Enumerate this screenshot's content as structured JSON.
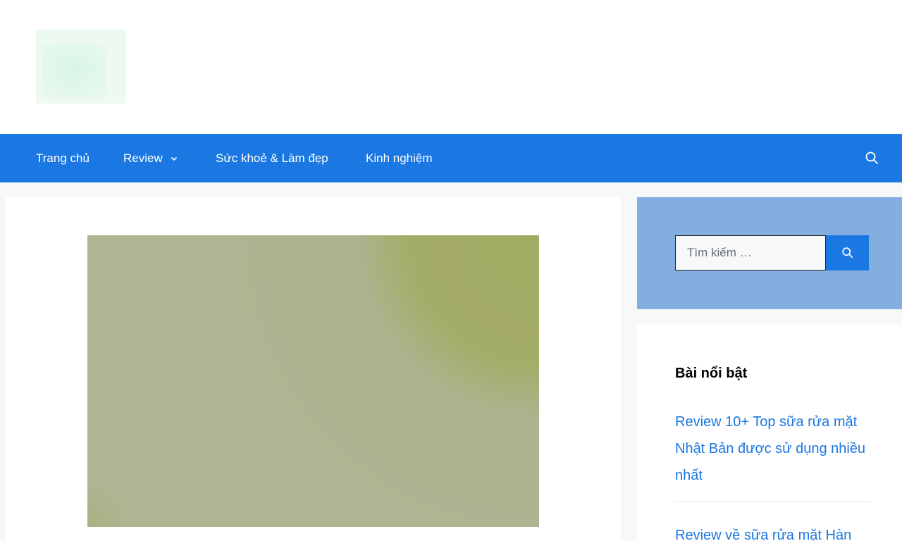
{
  "nav": {
    "items": [
      {
        "label": "Trang chủ"
      },
      {
        "label": "Review",
        "has_dropdown": true
      },
      {
        "label": "Sức khoẻ & Làm đẹp"
      },
      {
        "label": "Kinh nghiệm"
      }
    ],
    "search_icon": "search-icon"
  },
  "sidebar": {
    "search": {
      "placeholder": "Tìm kiếm …",
      "button_icon": "search-icon"
    },
    "featured": {
      "title": "Bài nổi bật",
      "posts": [
        {
          "title": "Review 10+ Top sữa rửa mặt Nhật Bản được sử dụng nhiều nhất"
        },
        {
          "title": "Review về sữa rửa mặt Hàn"
        }
      ]
    }
  },
  "colors": {
    "accent": "#1b78e2",
    "search_widget_bg": "#84aedf",
    "page_bg": "#f7f8f9"
  }
}
